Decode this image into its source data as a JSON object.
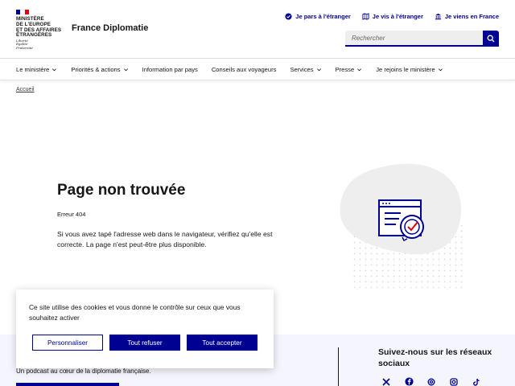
{
  "header": {
    "ministry_lines": [
      "MINISTÈRE",
      "DE L'EUROPE",
      "ET DES AFFAIRES",
      "ÉTRANGÈRES"
    ],
    "motto": [
      "Liberté",
      "Égalité",
      "Fraternité"
    ],
    "site_title": "France Diplomatie",
    "quicklinks": [
      {
        "label": "Je pars à l'étranger",
        "icon": "check-circle-icon"
      },
      {
        "label": "Je vis à l'étranger",
        "icon": "map-icon"
      },
      {
        "label": "Je viens en France",
        "icon": "building-icon"
      }
    ],
    "search": {
      "placeholder": "Rechercher",
      "icon": "search-icon"
    }
  },
  "nav": {
    "items": [
      {
        "label": "Le ministère",
        "has_dropdown": true
      },
      {
        "label": "Priorités & actions",
        "has_dropdown": true
      },
      {
        "label": "Information par pays",
        "has_dropdown": false
      },
      {
        "label": "Conseils aux voyageurs",
        "has_dropdown": false
      },
      {
        "label": "Services",
        "has_dropdown": true
      },
      {
        "label": "Presse",
        "has_dropdown": true
      },
      {
        "label": "Je rejoins le ministère",
        "has_dropdown": true
      }
    ]
  },
  "breadcrumb": {
    "current": "Accueil"
  },
  "main": {
    "title": "Page non trouvée",
    "code": "Erreur 404",
    "description": "Si vous avez tapé l'adresse web dans le navigateur, vérifiez qu'elle est correcte. La page n'est peut-être plus disponible."
  },
  "cookie": {
    "text": "Ce site utilise des cookies et vous donne le contrôle sur ceux que vous souhaitez activer",
    "customize_label": "Personnaliser",
    "refuse_label": "Tout refuser",
    "accept_label": "Tout accepter"
  },
  "footer": {
    "podcast_text": "Un podcast au cœur de la diplomatie française.",
    "social_title": "Suivez-nous sur les réseaux sociaux",
    "social_icons": [
      "x-icon",
      "facebook-icon",
      "threads-icon",
      "instagram-icon",
      "tiktok-icon"
    ]
  },
  "colors": {
    "primary": "#000091",
    "accent_red": "#e1000f",
    "text": "#161616",
    "footer_bg": "#f5f5fe"
  }
}
